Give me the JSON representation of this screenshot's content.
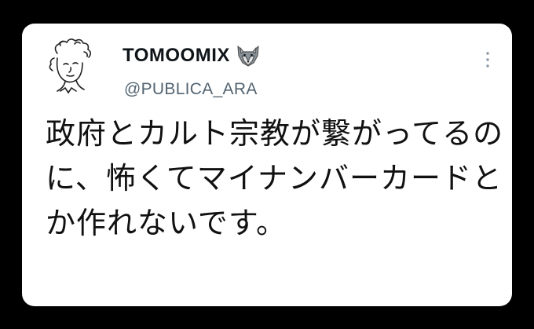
{
  "tweet": {
    "author": {
      "display_name": "TOMOOMIX",
      "name_emoji": "wolf-icon",
      "handle": "@PUBLICA_ARA",
      "avatar": "avatar-sketch"
    },
    "text": "政府とカルト宗教が繋がってるのに、怖くてマイナンバーカードとか作れないです。",
    "menu_icon": "more-options-icon"
  },
  "colors": {
    "background": "#000000",
    "card": "#ffffff",
    "text": "#111111",
    "handle": "#536471"
  }
}
